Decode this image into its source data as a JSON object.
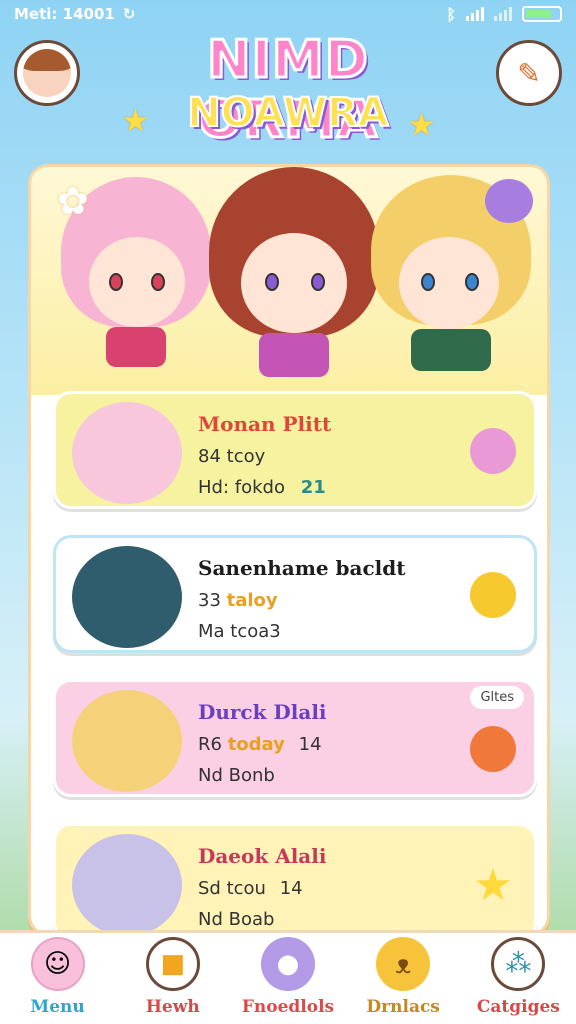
{
  "status_bar": {
    "left_text": "Meti: 14001",
    "left_icon": "sync-icon"
  },
  "header": {
    "title_line1": "NIMD ORMA",
    "title_line2": "NOAWRA",
    "avatar_icon": "profile-avatar-icon",
    "menu_icon": "settings-icon"
  },
  "cards": [
    {
      "title": "Monan Plitt",
      "line1_prefix": "84",
      "line1_word": "tcoy",
      "line2": "Hd: fokdo",
      "line2_num": "21",
      "title_color": "#e0473a"
    },
    {
      "title": "Sanenhame bacldt",
      "line1_prefix": "33",
      "line1_word": "taloy",
      "line2": "Ma tcoa3",
      "line2_num": "",
      "title_color": "#1d1d1d"
    },
    {
      "title": "Durck Dlali",
      "line1_prefix": "R6",
      "line1_word": "today",
      "line1_suffix": "14",
      "line2": "Nd Bonb",
      "line2_num": "",
      "title_color": "#6a3fc2"
    },
    {
      "title": "Daeok Alali",
      "line1_prefix": "Sd",
      "line1_word": "tcou",
      "line1_suffix": "14",
      "line2": "Nd Boab",
      "line2_num": "",
      "title_color": "#c43a5c"
    }
  ],
  "nav": [
    {
      "label": "Menu",
      "color": "#2aa7c9",
      "icon": "character-icon"
    },
    {
      "label": "Hewh",
      "color": "#d34a4a",
      "icon": "notification-icon"
    },
    {
      "label": "Fnoedlols",
      "color": "#e04848",
      "icon": "creature-icon"
    },
    {
      "label": "Drnlacs",
      "color": "#c28a22",
      "icon": "pet-icon"
    },
    {
      "label": "Catgiges",
      "color": "#d84848",
      "icon": "categories-icon"
    }
  ],
  "deco": {
    "bubble_text": "Gltes"
  }
}
